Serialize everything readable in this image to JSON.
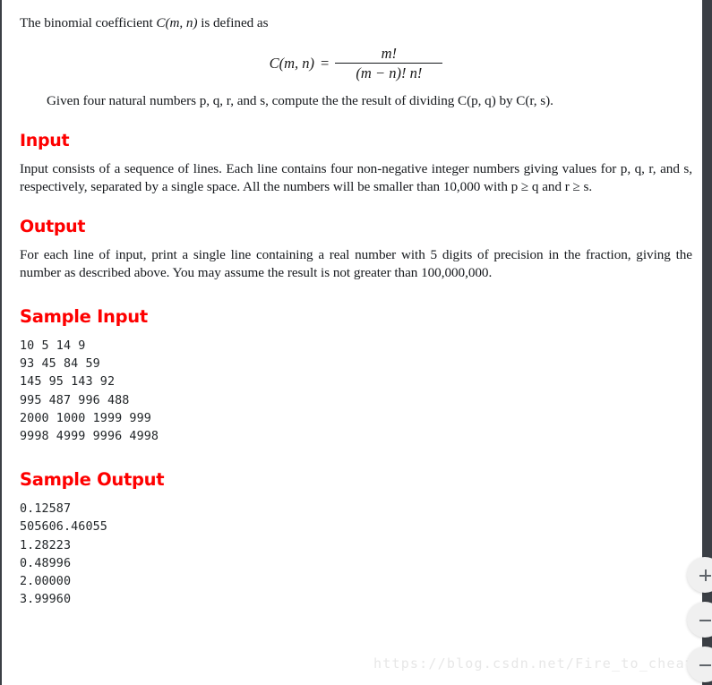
{
  "document": {
    "intro_paragraph": "The binomial coefficient C(m, n) is defined as",
    "intro_prefix": "The binomial coefficient ",
    "intro_math": "C(m, n)",
    "intro_suffix": " is defined as",
    "formula": {
      "lhs": "C(m, n)",
      "equals": "=",
      "numerator": "m!",
      "denominator": "(m − n)! n!"
    },
    "given_paragraph": "Given four natural numbers p, q, r, and s, compute the the result of dividing C(p, q) by C(r, s).",
    "sections": [
      {
        "heading": "Input",
        "body": "Input consists of a sequence of lines. Each line contains four non-negative integer numbers giving values for p, q, r, and s, respectively, separated by a single space. All the numbers will be smaller than 10,000 with p ≥ q and r ≥ s."
      },
      {
        "heading": "Output",
        "body": "For each line of input, print a single line containing a real number with 5 digits of precision in the fraction, giving the number as described above. You may assume the result is not greater than 100,000,000."
      }
    ],
    "sample_input": {
      "heading": "Sample Input",
      "lines": [
        "10 5 14 9",
        "93 45 84 59",
        "145 95 143 92",
        "995 487 996 488",
        "2000 1000 1999 999",
        "9998 4999 9996 4998"
      ]
    },
    "sample_output": {
      "heading": "Sample Output",
      "lines": [
        "0.12587",
        "505606.46055",
        "1.28223",
        "0.48996",
        "2.00000",
        "3.99960"
      ]
    },
    "watermark": "https://blog.csdn.net/Fire_to_cheat_"
  },
  "controls": {
    "zoom_in_label": "+",
    "zoom_out_label": "−",
    "extra_label": "−"
  },
  "colors": {
    "heading_red": "#fe0000",
    "body_text": "#15181c",
    "scrollbar": "#3b3f45",
    "watermark": "#e7e7e7"
  }
}
